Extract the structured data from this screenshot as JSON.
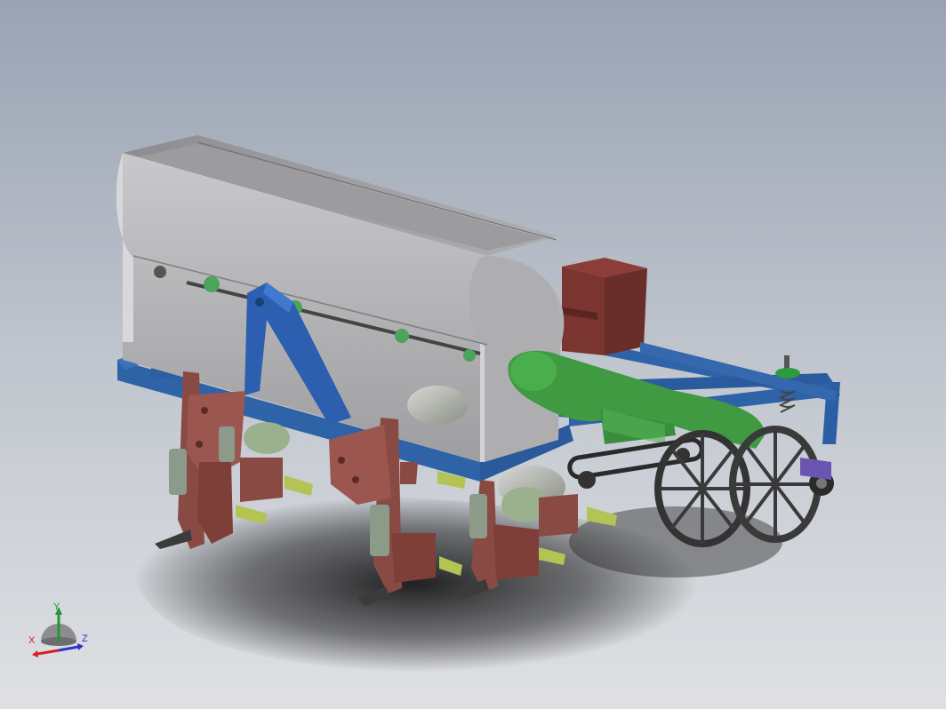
{
  "triad": {
    "x_label": "X",
    "y_label": "Y",
    "z_label": "Z",
    "x_color": "#d42020",
    "y_color": "#1e9a2e",
    "z_color": "#2b35c8"
  },
  "colors": {
    "background_top": "#99a3b3",
    "background_bottom": "#dfe0e4",
    "hopper": "#b4b4b6",
    "frame": "#2f63a8",
    "shanks": "#8a4a44",
    "seed_box": "#7a3530",
    "chute": "#3f9a42",
    "wheel": "#3a3a3a"
  },
  "icons": [
    "triad-icon"
  ]
}
